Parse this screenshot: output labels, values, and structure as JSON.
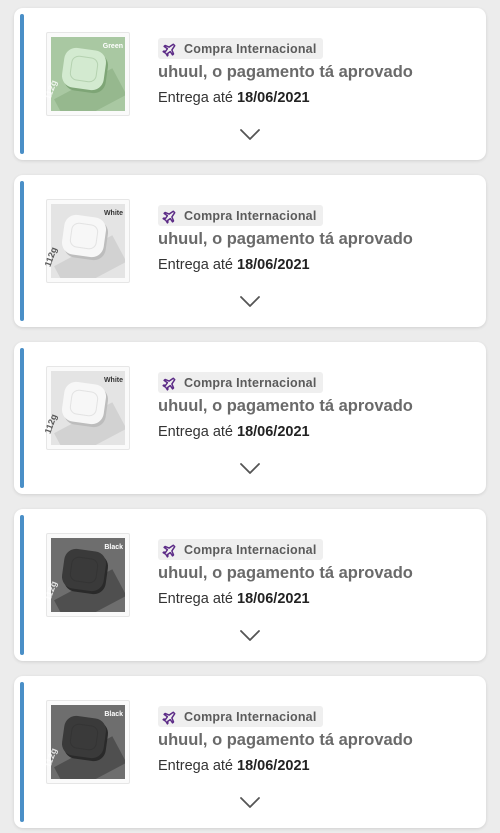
{
  "orders": [
    {
      "product_color": "Green",
      "product_weight": "112g",
      "thumb_palette": {
        "bg": "#a9c8a2",
        "body": "#d3ead0",
        "shade": "#7ea576",
        "text": "#ffffff"
      },
      "tag_icon": "airplane-icon",
      "tag_label": "Compra Internacional",
      "status": "uhuul, o pagamento tá aprovado",
      "delivery_prefix": "Entrega até",
      "delivery_date": "18/06/2021",
      "expand_icon": "chevron-down-icon"
    },
    {
      "product_color": "White",
      "product_weight": "112g",
      "thumb_palette": {
        "bg": "#e4e4e4",
        "body": "#f7f7f7",
        "shade": "#bdbdbd",
        "text": "#333333"
      },
      "tag_icon": "airplane-icon",
      "tag_label": "Compra Internacional",
      "status": "uhuul, o pagamento tá aprovado",
      "delivery_prefix": "Entrega até",
      "delivery_date": "18/06/2021",
      "expand_icon": "chevron-down-icon"
    },
    {
      "product_color": "White",
      "product_weight": "112g",
      "thumb_palette": {
        "bg": "#e4e4e4",
        "body": "#f7f7f7",
        "shade": "#bdbdbd",
        "text": "#333333"
      },
      "tag_icon": "airplane-icon",
      "tag_label": "Compra Internacional",
      "status": "uhuul, o pagamento tá aprovado",
      "delivery_prefix": "Entrega até",
      "delivery_date": "18/06/2021",
      "expand_icon": "chevron-down-icon"
    },
    {
      "product_color": "Black",
      "product_weight": "112g",
      "thumb_palette": {
        "bg": "#6e6e6e",
        "body": "#3a3a3a",
        "shade": "#2a2a2a",
        "text": "#ffffff"
      },
      "tag_icon": "airplane-icon",
      "tag_label": "Compra Internacional",
      "status": "uhuul, o pagamento tá aprovado",
      "delivery_prefix": "Entrega até",
      "delivery_date": "18/06/2021",
      "expand_icon": "chevron-down-icon"
    },
    {
      "product_color": "Black",
      "product_weight": "112g",
      "thumb_palette": {
        "bg": "#6e6e6e",
        "body": "#3a3a3a",
        "shade": "#2a2a2a",
        "text": "#ffffff"
      },
      "tag_icon": "airplane-icon",
      "tag_label": "Compra Internacional",
      "status": "uhuul, o pagamento tá aprovado",
      "delivery_prefix": "Entrega até",
      "delivery_date": "18/06/2021",
      "expand_icon": "chevron-down-icon"
    }
  ],
  "colors": {
    "accent_bar": "#4a8fc7",
    "plane_icon": "#5b2a86",
    "tag_bg": "#efefef",
    "page_bg": "#ececec"
  }
}
